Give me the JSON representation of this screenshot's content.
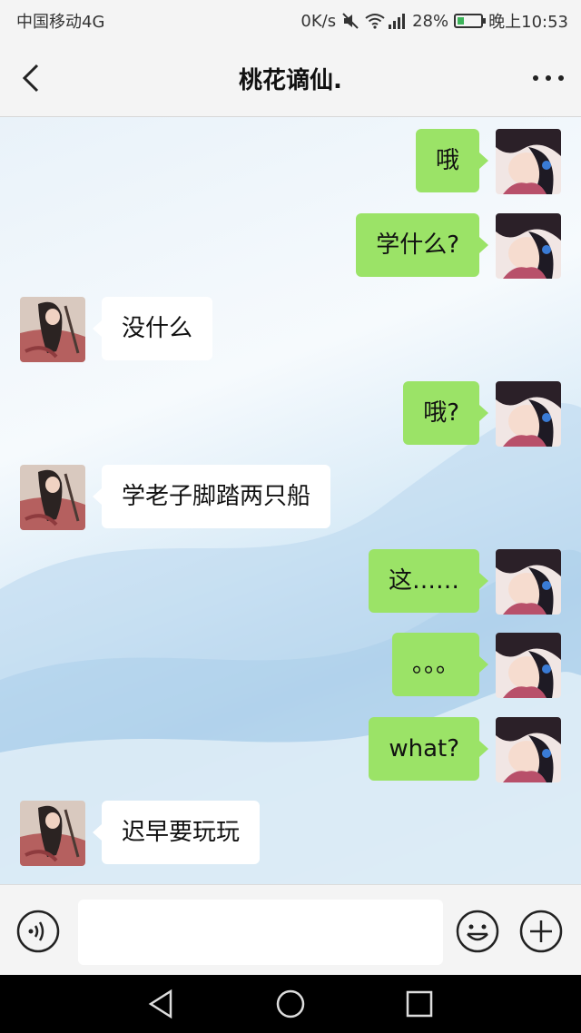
{
  "status_bar": {
    "carrier": "中国移动4G",
    "net_speed": "0K/s",
    "net_type": "4G",
    "battery": "28%",
    "battery_level": 0.28,
    "time": "晚上10:53"
  },
  "header": {
    "title": "桃花谪仙.",
    "back_icon": "chevron-left-icon",
    "more_icon": "more-dots-icon"
  },
  "messages": [
    {
      "side": "out",
      "text": "哦"
    },
    {
      "side": "out",
      "text": "学什么?"
    },
    {
      "side": "in",
      "text": "没什么"
    },
    {
      "side": "out",
      "text": "哦?"
    },
    {
      "side": "in",
      "text": "学老子脚踏两只船"
    },
    {
      "side": "out",
      "text": "这……"
    },
    {
      "side": "out",
      "text": "。。。"
    },
    {
      "side": "out",
      "text": "what?"
    },
    {
      "side": "in",
      "text": "迟早要玩玩"
    }
  ],
  "input_bar": {
    "voice_icon": "voice-icon",
    "message_value": "",
    "emoji_icon": "emoji-icon",
    "plus_icon": "plus-icon"
  },
  "colors": {
    "outgoing_bubble": "#9be367",
    "incoming_bubble": "#ffffff",
    "bar_background": "#f4f4f4"
  }
}
